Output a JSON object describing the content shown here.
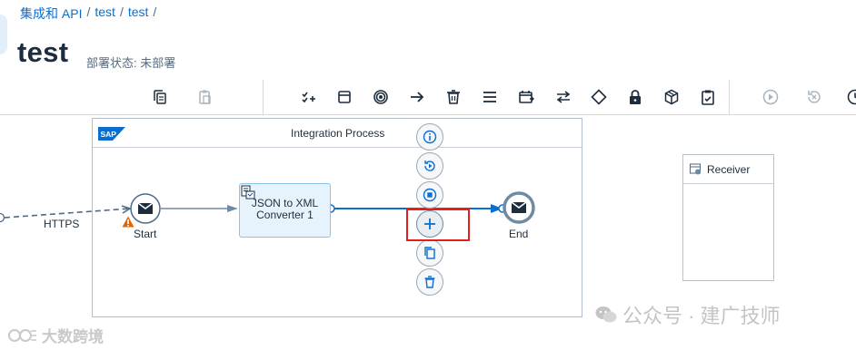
{
  "breadcrumb": [
    {
      "label": "集成和 API"
    },
    {
      "label": "test"
    },
    {
      "label": "test"
    }
  ],
  "breadcrumb_separator": "/",
  "page": {
    "title": "test",
    "deploy_status": "部署状态: 未部署"
  },
  "toolbar": {
    "left_icons": [
      "copy-icon",
      "paste-icon"
    ],
    "palette_icons": [
      "add-step-icon",
      "participant-icon",
      "event-icon",
      "connection-icon",
      "delete-icon",
      "list-icon",
      "schedule-icon",
      "swap-icon",
      "gateway-icon",
      "lock-icon",
      "package-icon",
      "clipboard-icon"
    ],
    "right_icons": [
      "play-icon",
      "reset-icon",
      "clock-icon"
    ]
  },
  "diagram": {
    "pool_title": "Integration Process",
    "sender_channel_label": "HTTPS",
    "start_label": "Start",
    "step_label": "JSON to XML Converter 1",
    "end_label": "End",
    "receiver_label": "Receiver",
    "context_buttons": [
      "info-icon",
      "replay-icon",
      "stop-icon",
      "add-icon",
      "copy-icon",
      "delete-icon"
    ],
    "highlighted_button": "add-icon"
  },
  "watermark": {
    "right": "公众号 · 建广技师",
    "left": "大数跨境"
  },
  "colors": {
    "link": "#0a6ed1",
    "accent_flow": "#0a6ed1",
    "step_fill": "#e6f3fc",
    "highlight_border": "#e0201f",
    "warning": "#e76500"
  }
}
